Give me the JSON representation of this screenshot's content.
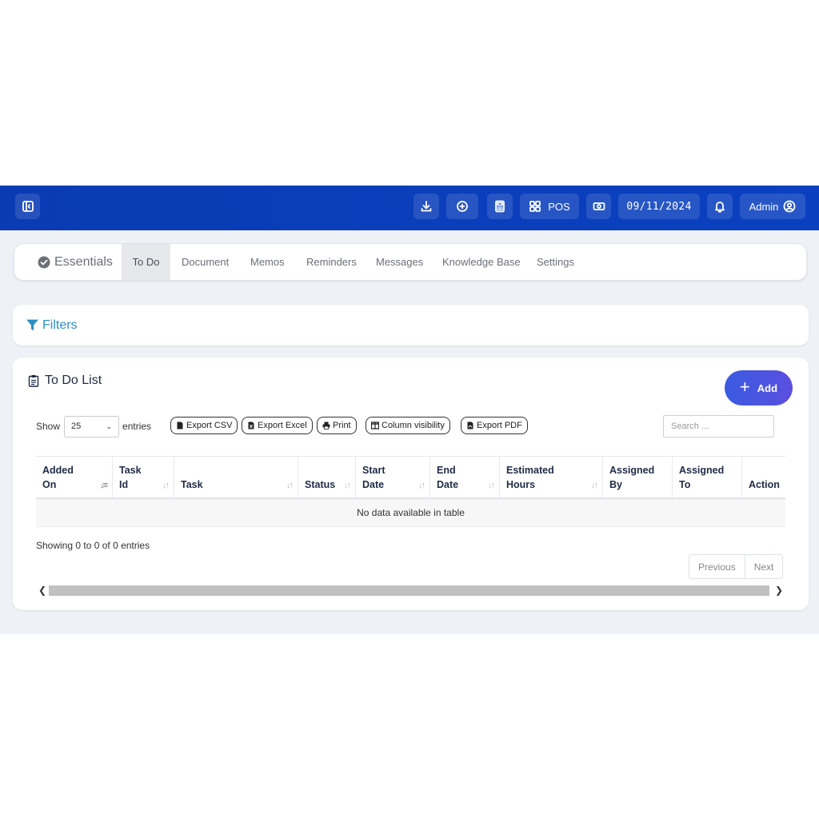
{
  "topbar": {
    "pos_label": "POS",
    "date": "09/11/2024",
    "user_label": "Admin"
  },
  "tabs": {
    "brand": "Essentials",
    "items": [
      "To Do",
      "Document",
      "Memos",
      "Reminders",
      "Messages",
      "Knowledge Base",
      "Settings"
    ],
    "active": "To Do"
  },
  "filters": {
    "label": "Filters"
  },
  "todo": {
    "title": "To Do List",
    "add_label": "Add",
    "show_label": "Show",
    "entries_label": "entries",
    "page_length": "25",
    "exports": [
      "Export CSV",
      "Export Excel",
      "Print",
      "Column visibility",
      "Export PDF"
    ],
    "search_placeholder": "Search ...",
    "columns": [
      {
        "line1": "Added",
        "line2": "On"
      },
      {
        "line1": "Task",
        "line2": "Id"
      },
      {
        "line1": "",
        "line2": "Task"
      },
      {
        "line1": "",
        "line2": "Status"
      },
      {
        "line1": "Start",
        "line2": "Date"
      },
      {
        "line1": "End",
        "line2": "Date"
      },
      {
        "line1": "Estimated",
        "line2": "Hours"
      },
      {
        "line1": "Assigned",
        "line2": "By"
      },
      {
        "line1": "Assigned",
        "line2": "To"
      },
      {
        "line1": "",
        "line2": "Action"
      }
    ],
    "empty_text": "No data available in table",
    "info_text": "Showing 0 to 0 of 0 entries",
    "prev_label": "Previous",
    "next_label": "Next"
  },
  "colors": {
    "topbar": "#0a3bb3",
    "accent": "#2b8fc4",
    "add_button": "#4a55e0"
  }
}
